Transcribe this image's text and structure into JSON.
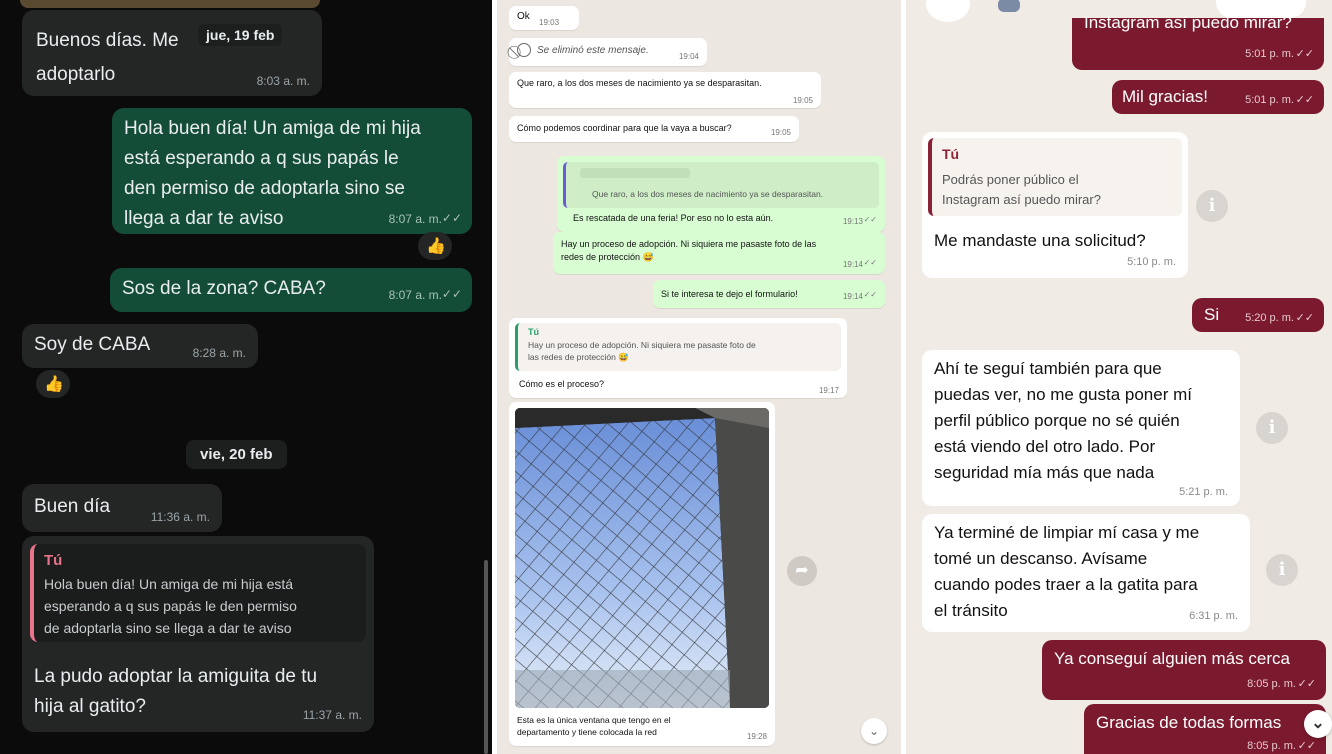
{
  "left": {
    "date_jue": "jue, 19 feb",
    "m1_line1": "Buenos días. Me",
    "m1_line2": "adoptarlo",
    "m1_time": "8:03 a. m.",
    "m2_lines": [
      "Hola buen día! Un amiga de mi hija",
      "está esperando a q sus papás le",
      "den permiso de adoptarla sino se",
      "llega a dar te aviso"
    ],
    "m2_time": "8:07 a. m.",
    "m3_text": "Sos de la zona? CABA?",
    "m3_time": "8:07 a. m.",
    "m4_text": "Soy de CABA",
    "m4_time": "8:28 a. m.",
    "date_vie": "vie, 20 feb",
    "m5_text": "Buen día",
    "m5_time": "11:36 a. m.",
    "m6_quote_author": "Tú",
    "m6_quote_lines": [
      "Hola buen día! Un amiga de mi hija está",
      "esperando a q sus papás le den permiso",
      "de adoptarla sino se llega a dar te aviso"
    ],
    "m6_lines": [
      "La pudo adoptar la amiguita de tu",
      "hija al gatito?"
    ],
    "m6_time": "11:37 a. m."
  },
  "middle": {
    "m1_text": "Ok",
    "m1_time": "19:03",
    "m2_text": "Se eliminó este mensaje.",
    "m2_time": "19:04",
    "m3_text": "Que raro, a los dos meses de nacimiento ya se desparasitan.",
    "m3_time": "19:05",
    "m4_text": "Cómo podemos coordinar para que la vaya a buscar?",
    "m4_time": "19:05",
    "m5_quote": "Que raro, a los dos meses de nacimiento ya se desparasitan.",
    "m5_text": "Es rescatada de una feria! Por eso no lo esta aún.",
    "m5_time": "19:13",
    "m6_lines": [
      "Hay un proceso de adopción.  Ni siquiera me pasaste foto de las",
      "redes de protección 😅"
    ],
    "m6_time": "19:14",
    "m7_text": "Si te interesa te dejo el formulario!",
    "m7_time": "19:14",
    "m8_quote_author": "Tú",
    "m8_quote_lines": [
      "Hay un proceso de adopción.  Ni siquiera me pasaste foto de",
      "las redes de protección 😅"
    ],
    "m8_text": "Cómo es el proceso?",
    "m8_time": "19:17",
    "m9_caption_lines": [
      "Esta es la única ventana que tengo en el",
      "departamento y tiene colocada la red"
    ],
    "m9_time": "19:28"
  },
  "right": {
    "top_partial": "Instagram así puedo mirar?",
    "top_time": "5:01 p. m.",
    "m1_text": "Mil gracias!",
    "m1_time": "5:01 p. m.",
    "m2_quote_author": "Tú",
    "m2_quote_lines": [
      "Podrás poner público el",
      "Instagram así puedo mirar?"
    ],
    "m2_text": "Me mandaste una solicitud?",
    "m2_time": "5:10 p. m.",
    "m3_text": "Si",
    "m3_time": "5:20 p. m.",
    "m4_lines": [
      "Ahí te seguí también para que",
      "puedas ver, no me gusta poner mí",
      "perfil público porque no sé quién",
      "está viendo del otro lado. Por",
      "seguridad mía más que nada"
    ],
    "m4_time": "5:21 p. m.",
    "m5_lines": [
      "Ya terminé de limpiar mí casa y me",
      "tomé un descanso. Avísame",
      "cuando podes traer a la gatita para",
      "el tránsito"
    ],
    "m5_time": "6:31 p. m.",
    "m6_text": "Ya conseguí alguien más cerca",
    "m6_time": "8:05 p. m.",
    "m7_text": "Gracias de todas formas",
    "m7_time": "8:05 p. m."
  },
  "colors": {
    "dark_out": "#144d37",
    "dark_in": "#242626",
    "light_out": "#d9fdd3",
    "maroon_out": "#7b1a2e",
    "read_tick": "#53bdeb"
  }
}
